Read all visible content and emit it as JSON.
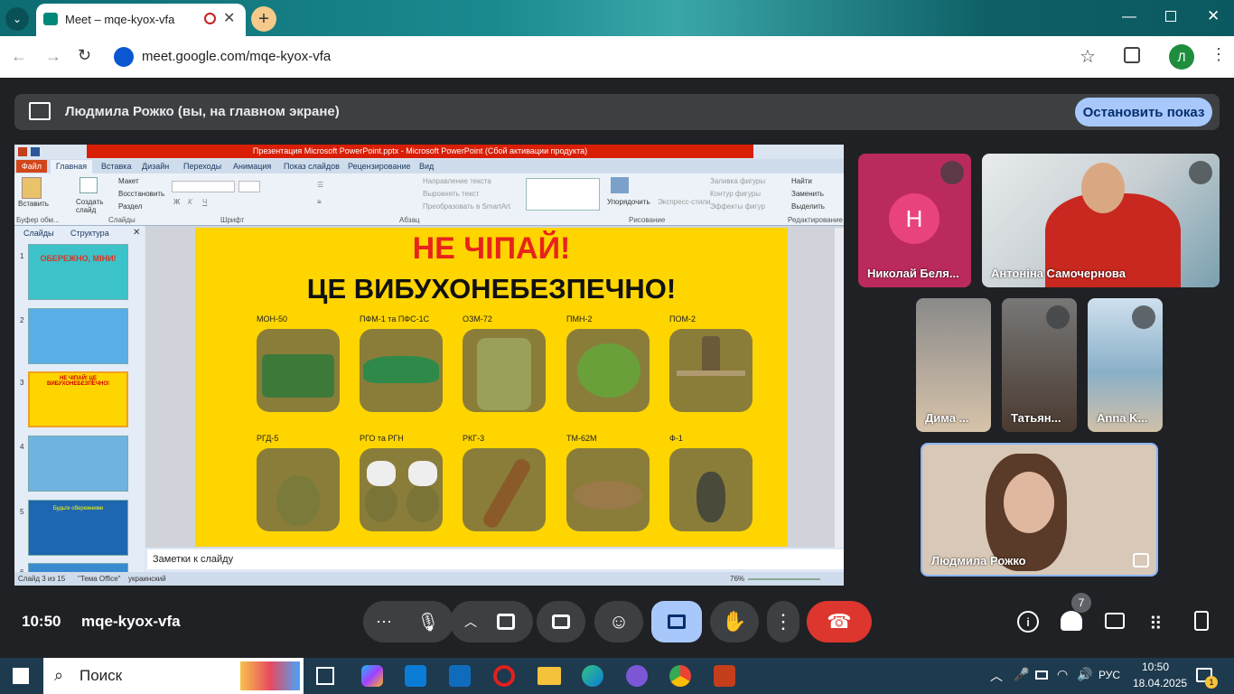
{
  "browser": {
    "tab_title": "Meet – mqe-kyox-vfa",
    "url": "meet.google.com/mqe-kyox-vfa",
    "profile_letter": "Л"
  },
  "share": {
    "presenter_text": "Людмила Рожко (вы, на главном экране)",
    "stop_label": "Остановить показ"
  },
  "ppt": {
    "title": "Презентация Microsoft PowerPoint.pptx  -  Microsoft PowerPoint (Сбой активации продукта)",
    "tabs": [
      "Файл",
      "Главная",
      "Вставка",
      "Дизайн",
      "Переходы",
      "Анимация",
      "Показ слайдов",
      "Рецензирование",
      "Вид"
    ],
    "groups": {
      "clipboard": "Буфер обм...",
      "slides": "Слайды",
      "font": "Шрифт",
      "paragraph": "Абзац",
      "drawing": "Рисование",
      "editing": "Редактирование"
    },
    "buttons": {
      "paste": "Вставить",
      "create_slide": "Создать слайд",
      "layout": "Макет",
      "restore": "Восстановить",
      "section": "Раздел",
      "text_direction": "Направление текста",
      "align_text": "Выровнять текст",
      "smartart": "Преобразовать в SmartArt",
      "arrange": "Упорядочить",
      "express_styles": "Экспресс-стили",
      "fill": "Заливка фигуры",
      "outline": "Контур фигуры",
      "effects": "Эффекты фигур",
      "find": "Найти",
      "replace": "Заменить",
      "select": "Выделить"
    },
    "panel_tabs": [
      "Слайды",
      "Структура"
    ],
    "thumbs": [
      {
        "num": "1",
        "text": "ОБЕРЕЖНО, МІНИ!"
      },
      {
        "num": "2",
        "text": ""
      },
      {
        "num": "3",
        "text": "НЕ ЧІПАЙ! ЦЕ ВИБУХОНЕБЕЗПЕЧНО!"
      },
      {
        "num": "4",
        "text": ""
      },
      {
        "num": "5",
        "text": "Будьте обережними"
      },
      {
        "num": "6",
        "text": ""
      }
    ],
    "slide": {
      "title1": "НЕ ЧІПАЙ!",
      "title2": "ЦЕ ВИБУХОНЕБЕЗПЕЧНО!",
      "items": [
        {
          "label": "МОН-50",
          "color": "#3d7a3a"
        },
        {
          "label": "ПФМ-1 та ПФС-1С",
          "color": "#2f8a4a"
        },
        {
          "label": "ОЗМ-72",
          "color": "#7c8a4a"
        },
        {
          "label": "ПМН-2",
          "color": "#5a8a32"
        },
        {
          "label": "ПОМ-2",
          "color": "#7a6a4a"
        },
        {
          "label": "РГД-5",
          "color": "#6f6a30"
        },
        {
          "label": "РГО та РГН",
          "color": "#7a6e3a"
        },
        {
          "label": "РКГ-3",
          "color": "#6a4a28"
        },
        {
          "label": "ТМ-62М",
          "color": "#8a6a40"
        },
        {
          "label": "Ф-1",
          "color": "#5a5a40"
        }
      ]
    },
    "notes": "Заметки к слайду",
    "status": {
      "slide": "Слайд 3 из 15",
      "theme": "\"Тема Office\"",
      "lang": "украинский",
      "zoom": "76%"
    }
  },
  "participants": [
    {
      "name": "Николай Беля...",
      "initial": "Н",
      "muted": true
    },
    {
      "name": "Антоніна Самочернова",
      "muted": true
    },
    {
      "name": "Дима ...",
      "muted": false
    },
    {
      "name": "Татьян...",
      "muted": true
    },
    {
      "name": "Anna K...",
      "muted": true
    },
    {
      "name": "Людмила Рожко",
      "muted": false
    }
  ],
  "meeting": {
    "time": "10:50",
    "code": "mqe-kyox-vfa",
    "people_count": "7"
  },
  "taskbar": {
    "search": "Поиск",
    "lang": "РУС",
    "time": "10:50",
    "date": "18.04.2025",
    "notif": "1"
  }
}
